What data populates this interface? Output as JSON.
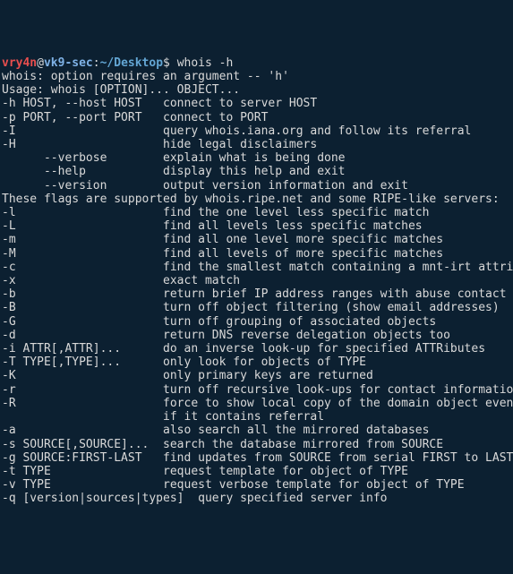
{
  "prompt": {
    "user": "vry4n",
    "at": "@",
    "host": "vk9-sec",
    "colon": ":",
    "tilde": "~/",
    "cwd": "Desktop",
    "dollar": "$ ",
    "command": "whois -h"
  },
  "out": {
    "l0": "whois: option requires an argument -- 'h'",
    "l1": "Usage: whois [OPTION]... OBJECT...",
    "l2": "",
    "l3": "-h HOST, --host HOST   connect to server HOST",
    "l4": "-p PORT, --port PORT   connect to PORT",
    "l5": "-I                     query whois.iana.org and follow its referral",
    "l6": "-H                     hide legal disclaimers",
    "l7": "      --verbose        explain what is being done",
    "l8": "      --help           display this help and exit",
    "l9": "      --version        output version information and exit",
    "l10": "",
    "l11": "These flags are supported by whois.ripe.net and some RIPE-like servers:",
    "l12": "-l                     find the one level less specific match",
    "l13": "-L                     find all levels less specific matches",
    "l14": "-m                     find all one level more specific matches",
    "l15": "-M                     find all levels of more specific matches",
    "l16": "-c                     find the smallest match containing a mnt-irt attribute",
    "l17": "-x                     exact match",
    "l18": "-b                     return brief IP address ranges with abuse contact",
    "l19": "-B                     turn off object filtering (show email addresses)",
    "l20": "-G                     turn off grouping of associated objects",
    "l21": "-d                     return DNS reverse delegation objects too",
    "l22": "-i ATTR[,ATTR]...      do an inverse look-up for specified ATTRibutes",
    "l23": "-T TYPE[,TYPE]...      only look for objects of TYPE",
    "l24": "-K                     only primary keys are returned",
    "l25": "-r                     turn off recursive look-ups for contact information",
    "l26": "-R                     force to show local copy of the domain object even",
    "l27": "                       if it contains referral",
    "l28": "-a                     also search all the mirrored databases",
    "l29": "-s SOURCE[,SOURCE]...  search the database mirrored from SOURCE",
    "l30": "-g SOURCE:FIRST-LAST   find updates from SOURCE from serial FIRST to LAST",
    "l31": "-t TYPE                request template for object of TYPE",
    "l32": "-v TYPE                request verbose template for object of TYPE",
    "l33": "-q [version|sources|types]  query specified server info"
  }
}
